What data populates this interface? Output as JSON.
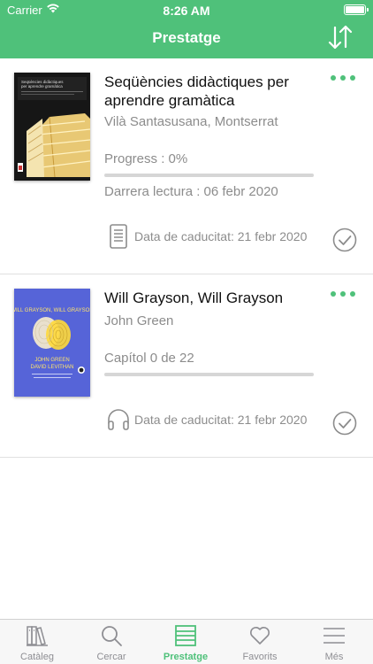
{
  "status_bar": {
    "carrier": "Carrier",
    "time": "8:26 AM"
  },
  "header": {
    "title": "Prestatge"
  },
  "books": [
    {
      "title": "Seqüències didàctiques per aprendre gramàtica",
      "author": "Vilà Santasusana, Montserrat",
      "progress_label": "Progress : 0%",
      "progress": 0,
      "last_read": "Darrera lectura : 06 febr 2020",
      "format": "ebook",
      "expiry": "Data de caducitat: 21 febr 2020",
      "cover": {
        "title": "Seqüències didàctiques per aprendre gramàtica",
        "bg": "#1c1c1c"
      }
    },
    {
      "title": "Will Grayson, Will Grayson",
      "author": "John Green",
      "progress_label": "Capítol 0 de 22",
      "progress": 0,
      "format": "audiobook",
      "expiry": "Data de caducitat: 21 febr 2020",
      "cover": {
        "title": "WILL GRAYSON, WILL GRAYSON",
        "authors": "JOHN GREEN DAVID LEVITHAN",
        "bg": "#5664d8"
      }
    }
  ],
  "tabs": [
    {
      "label": "Catàleg",
      "icon": "books-icon",
      "active": false
    },
    {
      "label": "Cercar",
      "icon": "search-icon",
      "active": false
    },
    {
      "label": "Prestatge",
      "icon": "shelf-icon",
      "active": true
    },
    {
      "label": "Favorits",
      "icon": "heart-icon",
      "active": false
    },
    {
      "label": "Més",
      "icon": "menu-icon",
      "active": false
    }
  ],
  "colors": {
    "accent": "#4fc17a",
    "muted": "#8c8c8c",
    "tab_inactive": "#8e8e93"
  }
}
